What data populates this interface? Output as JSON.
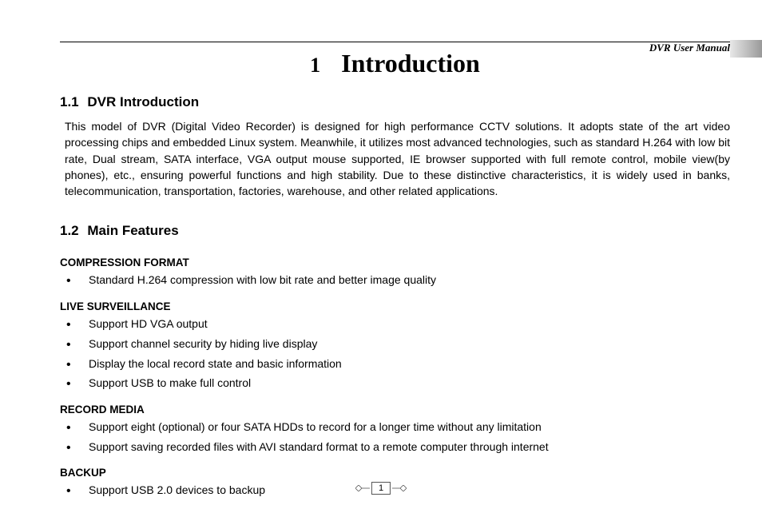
{
  "header": {
    "manual_title": "DVR User Manual"
  },
  "chapter": {
    "number": "1",
    "title": "Introduction"
  },
  "section1": {
    "number": "1.1",
    "title": "DVR Introduction",
    "body": "This model of DVR (Digital Video Recorder) is designed for high performance CCTV solutions. It adopts state of the art video processing chips and embedded Linux system. Meanwhile, it utilizes most advanced technologies, such as standard H.264 with low bit rate, Dual stream, SATA interface, VGA output mouse supported, IE browser supported with full remote control, mobile view(by phones), etc., ensuring powerful functions and high stability. Due to these distinctive characteristics, it is widely used in banks, telecommunication, transportation, factories, warehouse, and other related applications."
  },
  "section2": {
    "number": "1.2",
    "title": "Main Features"
  },
  "features": {
    "compression": {
      "heading": "COMPRESSION FORMAT",
      "items": [
        "Standard H.264 compression with low bit rate and better image quality"
      ]
    },
    "live": {
      "heading": "LIVE SURVEILLANCE",
      "items": [
        "Support HD VGA output",
        "Support channel security by hiding live display",
        "Display the local record state and basic information",
        "Support USB to make full control"
      ]
    },
    "record": {
      "heading": "RECORD MEDIA",
      "items": [
        "Support eight (optional) or four SATA HDDs to record for a longer time without any limitation",
        "Support saving recorded files with AVI standard format to a remote computer through internet"
      ]
    },
    "backup": {
      "heading": "BACKUP",
      "items": [
        "Support USB 2.0 devices to backup"
      ]
    }
  },
  "footer": {
    "page_number": "1"
  }
}
